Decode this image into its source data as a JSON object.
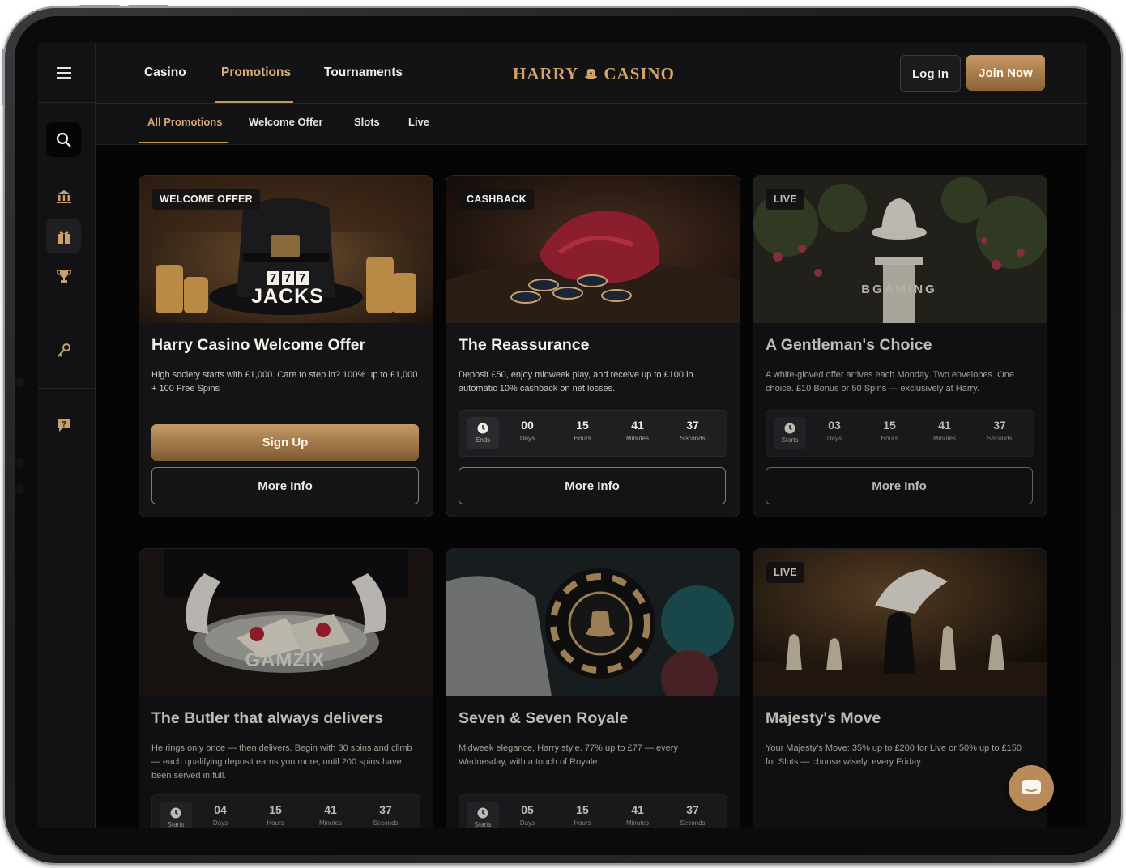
{
  "brand": {
    "logo_left": "HARRY",
    "logo_right": "CASINO"
  },
  "nav": {
    "items": [
      {
        "label": "Casino"
      },
      {
        "label": "Promotions"
      },
      {
        "label": "Tournaments"
      }
    ],
    "active": "Promotions"
  },
  "auth": {
    "login_label": "Log In",
    "join_label": "Join Now"
  },
  "subnav": {
    "items": [
      {
        "label": "All Promotions"
      },
      {
        "label": "Welcome Offer"
      },
      {
        "label": "Slots"
      },
      {
        "label": "Live"
      }
    ],
    "active": "All Promotions"
  },
  "sidebar": {
    "icons": [
      "menu-icon",
      "search-icon",
      "bank-icon",
      "gift-icon",
      "trophy-icon",
      "key-icon",
      "help-icon"
    ]
  },
  "colors": {
    "accent": "#c79a61",
    "background": "#050506",
    "panel": "#141416"
  },
  "cards": [
    {
      "badge": "WELCOME OFFER",
      "image_text": "JACKS",
      "image_reels": [
        "7",
        "7",
        "7"
      ],
      "title": "Harry Casino Welcome Offer",
      "desc": "High society starts with £1,000. Care to step in? 100% up to £1,000 + 100 Free Spins",
      "primary_label": "Sign Up",
      "secondary_label": "More Info"
    },
    {
      "badge": "CASHBACK",
      "title": "The Reassurance",
      "desc": "Deposit £50, enjoy midweek play, and receive up to £100 in automatic 10% cashback on net losses.",
      "timer": {
        "label": "Ends",
        "days": "00",
        "hours": "15",
        "minutes": "41",
        "seconds": "37",
        "u_days": "Days",
        "u_hours": "Hours",
        "u_minutes": "Minutes",
        "u_seconds": "Seconds"
      },
      "secondary_label": "More Info"
    },
    {
      "badge": "LIVE",
      "image_text": "BGAMING",
      "title": "A Gentleman's Choice",
      "desc": "A white-gloved offer arrives each Monday. Two envelopes. One choice. £10 Bonus or 50 Spins — exclusively at Harry.",
      "timer": {
        "label": "Starts",
        "days": "03",
        "hours": "15",
        "minutes": "41",
        "seconds": "37",
        "u_days": "Days",
        "u_hours": "Hours",
        "u_minutes": "Minutes",
        "u_seconds": "Seconds"
      },
      "secondary_label": "More Info"
    },
    {
      "image_text": "GAMZIX",
      "title": "The Butler that always delivers",
      "desc": "He rings only once — then delivers. Begin with 30 spins and climb — each qualifying deposit earns you more, until 200 spins have been served in full.",
      "timer": {
        "label": "Starts",
        "days": "04",
        "hours": "15",
        "minutes": "41",
        "seconds": "37",
        "u_days": "Days",
        "u_hours": "Hours",
        "u_minutes": "Minutes",
        "u_seconds": "Seconds"
      }
    },
    {
      "title": "Seven & Seven Royale",
      "desc": "Midweek elegance, Harry style. 77% up to £77 — every Wednesday, with a touch of Royale",
      "timer": {
        "label": "Starts",
        "days": "05",
        "hours": "15",
        "minutes": "41",
        "seconds": "37",
        "u_days": "Days",
        "u_hours": "Hours",
        "u_minutes": "Minutes",
        "u_seconds": "Seconds"
      }
    },
    {
      "badge": "LIVE",
      "title": "Majesty's Move",
      "desc": "Your Majesty's Move: 35% up to £200 for Live or 50% up to £150 for Slots — choose wisely, every Friday."
    }
  ]
}
